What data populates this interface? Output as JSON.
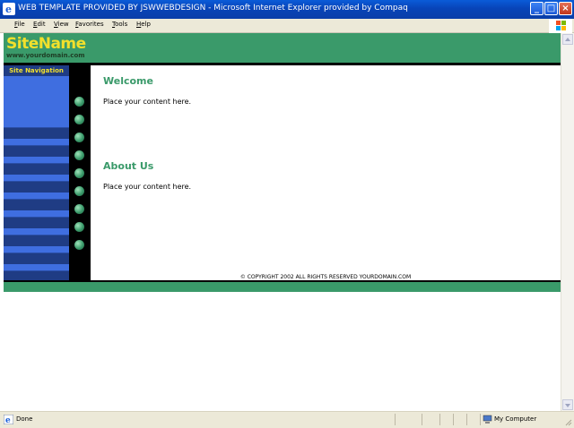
{
  "window": {
    "title": "WEB TEMPLATE PROVIDED BY JSWWEBDESIGN - Microsoft Internet Explorer provided by Compaq",
    "controls": [
      "minimize",
      "maximize",
      "close"
    ]
  },
  "menu": {
    "items": [
      "File",
      "Edit",
      "View",
      "Favorites",
      "Tools",
      "Help"
    ]
  },
  "site": {
    "name": "SiteName",
    "url": "www.yourdomain.com",
    "colors": {
      "header_green": "#3a9a6a",
      "logo_yellow": "#f2e02c",
      "nav_blue": "#3f6ee0",
      "nav_dark": "#1f3c84"
    }
  },
  "nav": {
    "title": "Site Navigation",
    "item_count": 9
  },
  "content": {
    "sections": [
      {
        "heading": "Welcome",
        "body": "Place your content here."
      },
      {
        "heading": "About Us",
        "body": "Place your content here."
      }
    ],
    "copyright": "© COPYRIGHT 2002 ALL RIGHTS RESERVED YOURDOMAIN.COM"
  },
  "status": {
    "text": "Done",
    "zone": "My Computer"
  }
}
